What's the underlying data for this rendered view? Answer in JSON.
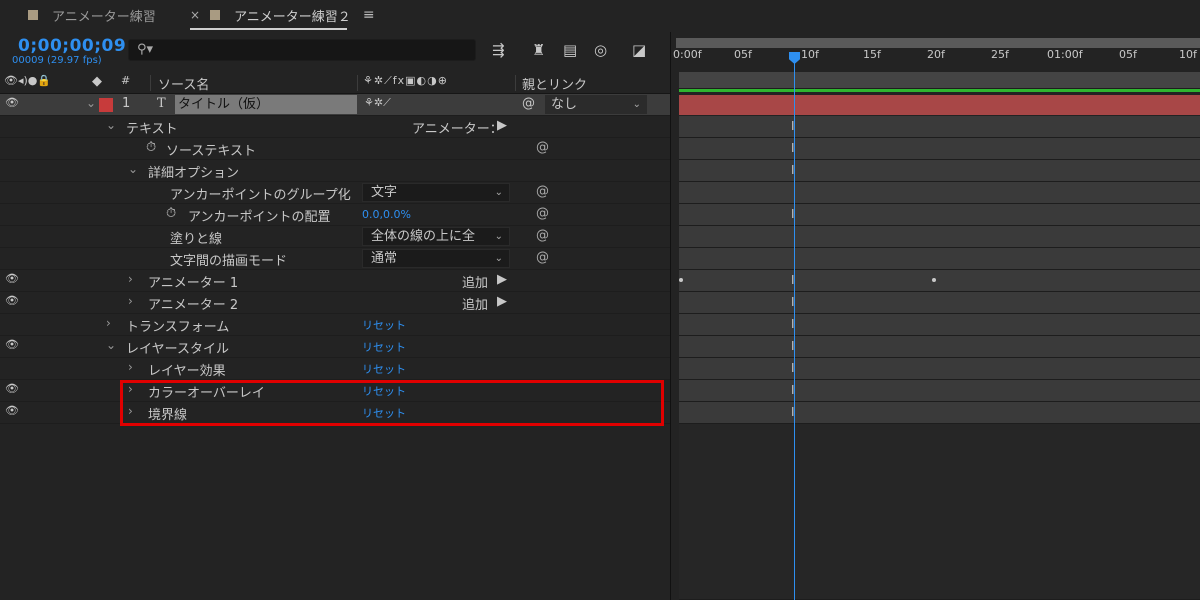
{
  "tabs": [
    {
      "label": "アニメーター練習"
    },
    {
      "label": "アニメーター練習２"
    }
  ],
  "timecode": "0;00;00;09",
  "fps": "00009 (29.97 fps)",
  "search": {
    "placeholder": ""
  },
  "columns": {
    "num": "#",
    "source": "ソース名",
    "parent": "親とリンク"
  },
  "layer": {
    "number": "1",
    "type": "T",
    "name": "タイトル（仮）",
    "parent": "なし",
    "color": "#c73b3b"
  },
  "rows": {
    "text": "テキスト",
    "animator_menu": "アニメーター：",
    "source_text": "ソーステキスト",
    "more_options": "詳細オプション",
    "anchor_grouping": "アンカーポイントのグループ化",
    "anchor_grouping_value": "文字",
    "anchor_align": "アンカーポイントの配置",
    "anchor_align_value": "0.0,0.0%",
    "fill_stroke": "塗りと線",
    "fill_stroke_value": "全体の線の上に全",
    "inter_char_blend": "文字間の描画モード",
    "inter_char_blend_value": "通常",
    "animator1": "アニメーター 1",
    "animator2": "アニメーター 2",
    "add": "追加",
    "transform": "トランスフォーム",
    "layer_styles": "レイヤースタイル",
    "blending_options": "レイヤー効果",
    "color_overlay": "カラーオーバーレイ",
    "stroke": "境界線",
    "reset": "リセット"
  },
  "ruler": [
    "0:00f",
    "05f",
    "10f",
    "15f",
    "20f",
    "25f",
    "01:00f",
    "05f",
    "10f"
  ]
}
